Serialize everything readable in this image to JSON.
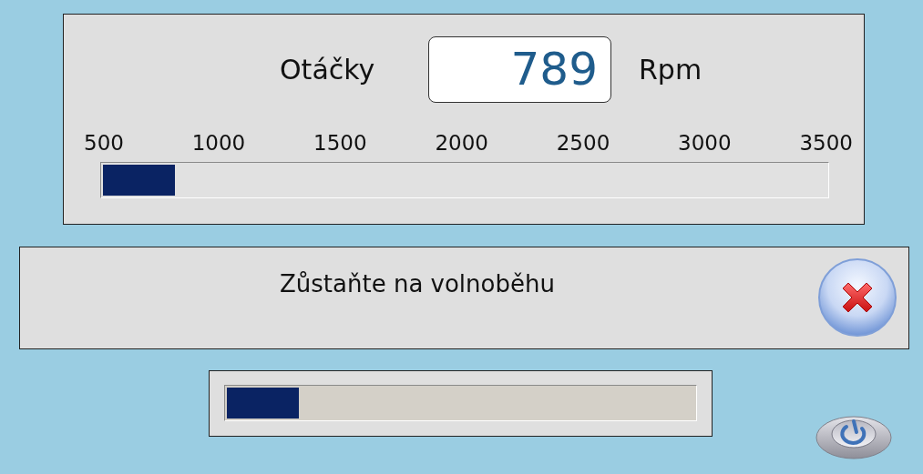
{
  "speed_panel": {
    "label": "Otáčky",
    "value": "789",
    "unit": "Rpm",
    "scale_ticks": [
      "500",
      "1000",
      "1500",
      "2000",
      "2500",
      "3000",
      "3500"
    ],
    "gauge": {
      "level": 0.1
    }
  },
  "message_panel": {
    "message": "Zůstaňte na volnoběhu"
  },
  "progress": {
    "level": 0.154
  }
}
